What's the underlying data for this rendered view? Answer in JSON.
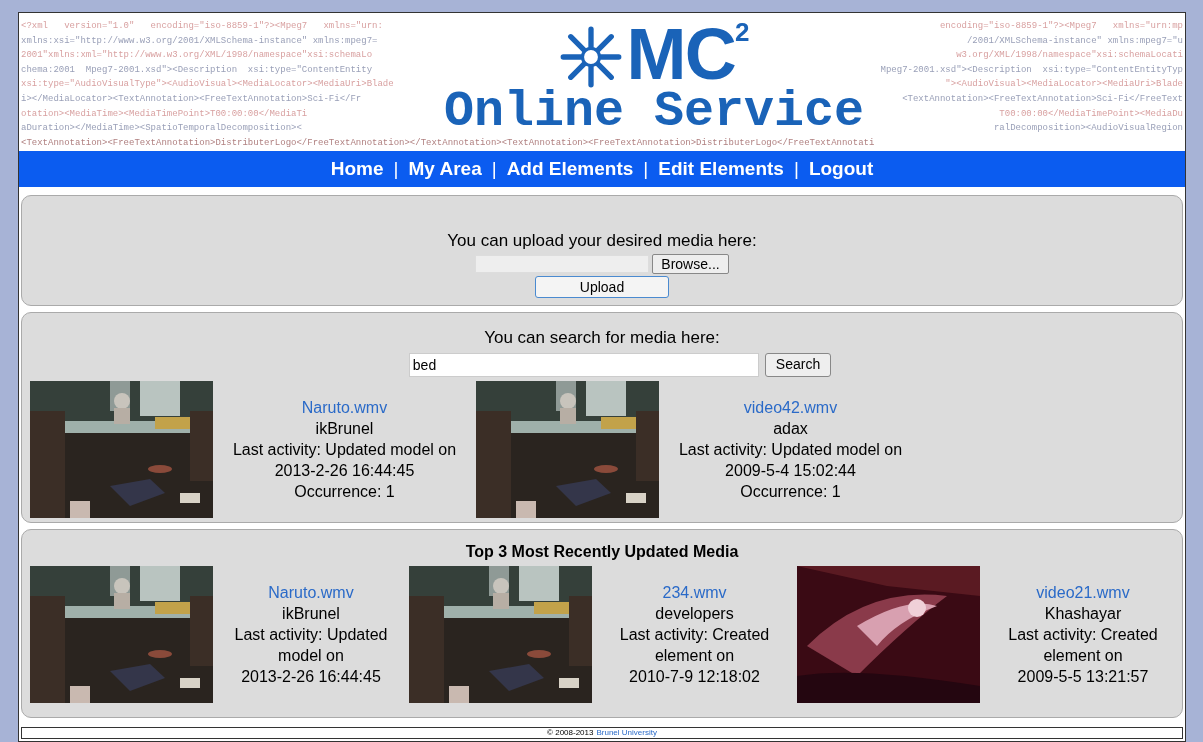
{
  "banner": {
    "xml_left": [
      "<?xml   version=\"1.0\"   encoding=\"iso-8859-1\"?><Mpeg7   xmlns=\"urn:",
      "xmlns:xsi=\"http://www.w3.org/2001/XMLSchema-instance\" xmlns:mpeg7=",
      "2001\"xmlns:xml=\"http://www.w3.org/XML/1998/namespace\"xsi:schemaLo",
      "chema:2001  Mpeg7-2001.xsd\"><Description  xsi:type=\"ContentEntity",
      "xsi:type=\"AudioVisualType\"><AudioVisual><MediaLocator><MediaUri>Blade",
      "i></MediaLocator><TextAnnotation><FreeTextAnnotation>Sci-Fi</Fr",
      "otation><MediaTime><MediaTimePoint>T00:00:00</MediaTi",
      "aDuration></MediaTime><SpatioTemporalDecomposition><"
    ],
    "xml_right": [
      "encoding=\"iso-8859-1\"?><Mpeg7   xmlns=\"urn:mp",
      "/2001/XMLSchema-instance\" xmlns:mpeg7=\"u",
      "w3.org/XML/1998/namespace\"xsi:schemaLocati",
      "Mpeg7-2001.xsd\"><Description  xsi:type=\"ContentEntityTyp",
      "\"><AudioVisual><MediaLocator><MediaUri>Blade",
      "<TextAnnotation><FreeTextAnnotation>Sci-Fi</FreeText",
      "T00:00:00</MediaTimePoint><MediaDu",
      "ralDecomposition><AudioVisualRegion"
    ],
    "xml_bottom": "<TextAnnotation><FreeTextAnnotation>DistributerLogo</FreeTextAnnotation></TextAnnotation><TextAnnotation><FreeTextAnnotation>DistributerLogo</FreeTextAnnotati",
    "logo_main": "MC",
    "logo_sup": "2",
    "logo_sub": "Online Service"
  },
  "nav": [
    "Home",
    "My Area",
    "Add Elements",
    "Edit Elements",
    "Logout"
  ],
  "nav_separator": "|",
  "upload": {
    "prompt": "You can upload your desired media here:",
    "browse": "Browse...",
    "button": "Upload"
  },
  "search": {
    "prompt": "You can search for media here:",
    "value": "bed",
    "button": "Search",
    "results": [
      {
        "title": "Naruto.wmv",
        "user": "ikBrunel",
        "activity": "Last activity: Updated model on",
        "time": "2013-2-26 16:44:45",
        "occurrence": "Occurrence: 1"
      },
      {
        "title": "video42.wmv",
        "user": "adax",
        "activity": "Last activity: Updated model on",
        "time": "2009-5-4 15:02:44",
        "occurrence": "Occurrence: 1"
      }
    ]
  },
  "recent": {
    "title": "Top 3 Most Recently Updated Media",
    "items": [
      {
        "title": "Naruto.wmv",
        "user": "ikBrunel",
        "activity": "Last activity: Updated model on",
        "time": "2013-2-26 16:44:45"
      },
      {
        "title": "234.wmv",
        "user": "developers",
        "activity": "Last activity: Created element on",
        "time": "2010-7-9 12:18:02"
      },
      {
        "title": "video21.wmv",
        "user": "Khashayar",
        "activity": "Last activity: Created element on",
        "time": "2009-5-5 13:21:57"
      }
    ]
  },
  "footer": {
    "text": "© 2008-2013",
    "link": "Brunel University"
  }
}
